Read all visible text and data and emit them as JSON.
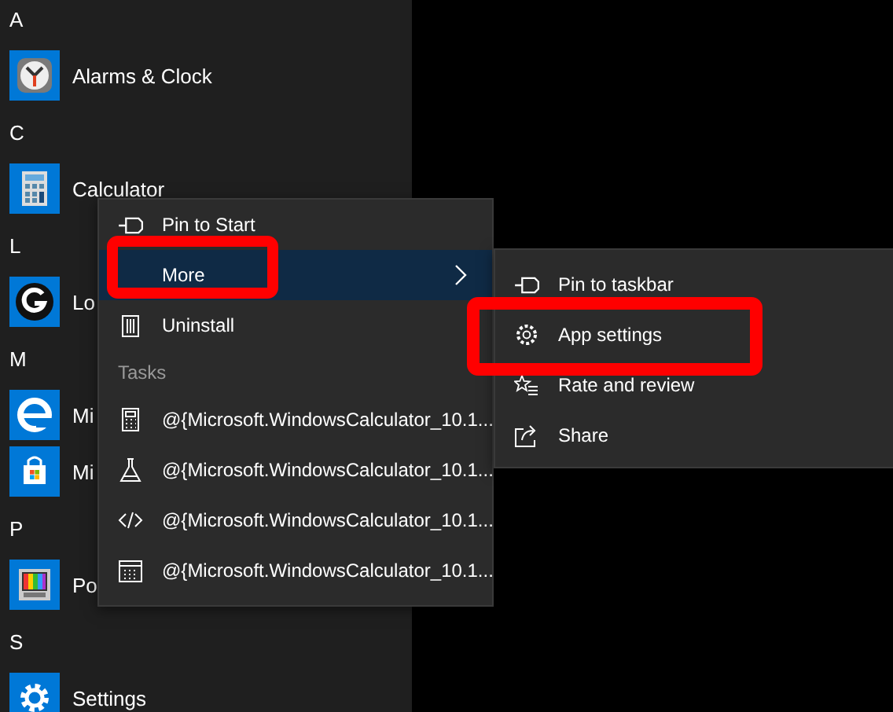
{
  "start_list": {
    "sections": [
      {
        "letter": "A",
        "apps": [
          {
            "name": "Alarms & Clock",
            "kind": "clock"
          }
        ]
      },
      {
        "letter": "C",
        "apps": [
          {
            "name": "Calculator",
            "kind": "calculator"
          }
        ]
      },
      {
        "letter": "L",
        "apps": [
          {
            "name": "Lo",
            "kind": "logo"
          }
        ]
      },
      {
        "letter": "M",
        "apps": [
          {
            "name": "Mi",
            "kind": "browser"
          },
          {
            "name": "Mi",
            "kind": "store"
          }
        ]
      },
      {
        "letter": "P",
        "apps": [
          {
            "name": "Po",
            "kind": "paint"
          }
        ]
      },
      {
        "letter": "S",
        "apps": [
          {
            "name": "Settings",
            "kind": "settings"
          }
        ]
      }
    ]
  },
  "context_menu": {
    "items": [
      {
        "label": "Pin to Start",
        "kind": "pin",
        "selected": false
      },
      {
        "label": "More",
        "kind": "more",
        "selected": true
      },
      {
        "label": "Uninstall",
        "kind": "uninstall",
        "selected": false
      }
    ],
    "tasks_heading": "Tasks",
    "tasks": [
      {
        "label": "@{Microsoft.WindowsCalculator_10.1...",
        "kind": "calculator"
      },
      {
        "label": "@{Microsoft.WindowsCalculator_10.1...",
        "kind": "flask"
      },
      {
        "label": "@{Microsoft.WindowsCalculator_10.1...",
        "kind": "code"
      },
      {
        "label": "@{Microsoft.WindowsCalculator_10.1...",
        "kind": "calendar"
      }
    ]
  },
  "submenu": {
    "items": [
      {
        "label": "Pin to taskbar",
        "kind": "pin",
        "selected": false
      },
      {
        "label": "App settings",
        "kind": "gear",
        "selected": false
      },
      {
        "label": "Rate and review",
        "kind": "rate",
        "selected": false
      },
      {
        "label": "Share",
        "kind": "share",
        "selected": false
      }
    ]
  }
}
